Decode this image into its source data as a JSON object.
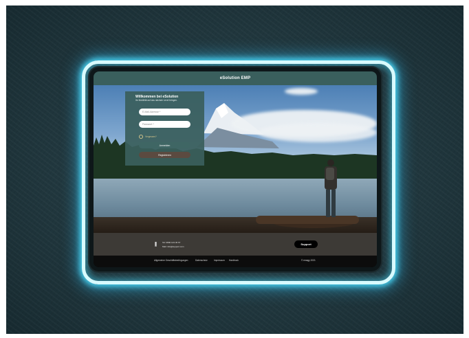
{
  "app": {
    "title": "eSolution EMP"
  },
  "login": {
    "title": "Willkommen bei eSolution",
    "subtitle": "Ihr Mobilität auf das nächste Level bringen.",
    "email_placeholder": "E-Mail-Adresse *",
    "password_placeholder": "Passwort *",
    "remember_label": "Vergessen?",
    "login_button": "Anmelden",
    "register_button": "Registrieren"
  },
  "footer": {
    "phone": "Tel: 0800 123 45 67",
    "email": "Mail: info@support.com",
    "support_button": "Support",
    "links": [
      "Allgemeine Geschäftsbedingungen",
      "Datenschutz",
      "Impressum",
      "Hardtruck"
    ],
    "copyright": "© emagy 2021"
  },
  "colors": {
    "topbar": "#3a5f5d",
    "login_panel": "#3a5f5d",
    "register_button": "#5b4a40",
    "footer": "#3d3a36",
    "neon_frame": "#48d0ee"
  },
  "icons": {
    "contact": "phone-icon"
  }
}
